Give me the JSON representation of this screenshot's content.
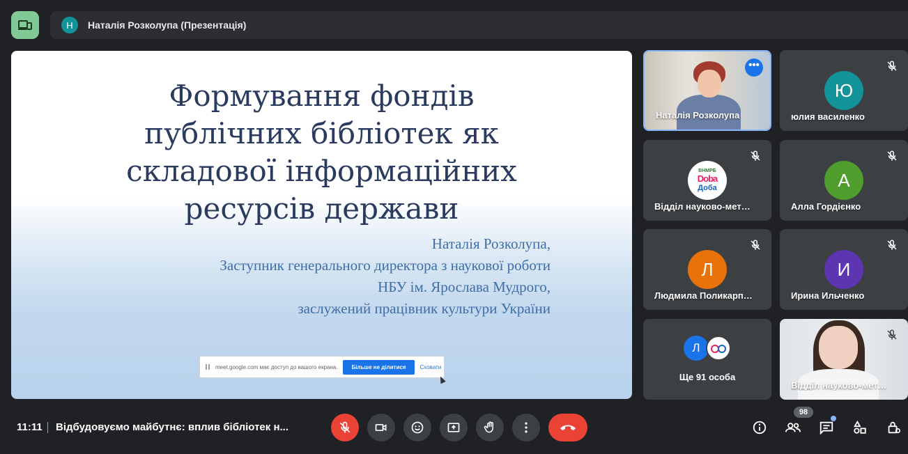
{
  "header": {
    "presenter_initial": "Н",
    "presenter_label": "Наталія Розколупа (Презентація)"
  },
  "slide": {
    "title_lines": [
      "Формування фондів",
      "публічних бібліотек як",
      "складової інформаційних",
      "ресурсів держави"
    ],
    "author_lines": [
      "Наталія Розколупа,",
      "Заступник генерального директора з наукової роботи",
      "НБУ ім. Ярослава Мудрого,",
      "заслужений працівник культури України"
    ],
    "share_notice": {
      "text": "meet.google.com має доступ до вашого екрана.",
      "stop_label": "Більше не ділитися",
      "hide_label": "Сховати"
    }
  },
  "participants": [
    {
      "name": "Наталія Розколупа",
      "type": "video",
      "active": true
    },
    {
      "name": "юлия василенко",
      "initial": "Ю",
      "color": "#12939a"
    },
    {
      "name": "Відділ науково-мет…",
      "type": "logo",
      "logo": {
        "top": "ВНМРБ",
        "mid": "Doba",
        "bottom": "Доба"
      }
    },
    {
      "name": "Алла Гордієнко",
      "initial": "А",
      "color": "#4f9d2d"
    },
    {
      "name": "Людмила Поликарп…",
      "initial": "Л",
      "color": "#e8710a"
    },
    {
      "name": "Ирина Ильченко",
      "initial": "И",
      "color": "#5e35b1"
    },
    {
      "name": "Відділ науково-мет…",
      "type": "video"
    }
  ],
  "more_people": {
    "initial": "Л",
    "initial_color": "#1a73e8",
    "label": "Ще 91 особа"
  },
  "bottom_bar": {
    "time": "11:11",
    "meeting_title": "Відбудовуємо майбутнє: вплив бібліотек н...",
    "participants_count": "98"
  },
  "colors": {
    "background": "#202124",
    "tile": "#3c4043",
    "danger": "#ea4335",
    "accent": "#8ab4f8",
    "layout_button": "#81c995"
  },
  "icons": [
    "layout-icon",
    "mic-off-icon",
    "camera-icon",
    "emoji-icon",
    "present-icon",
    "raise-hand-icon",
    "more-options-icon",
    "hang-up-icon",
    "info-icon",
    "people-icon",
    "chat-icon",
    "activities-icon",
    "host-controls-icon"
  ]
}
